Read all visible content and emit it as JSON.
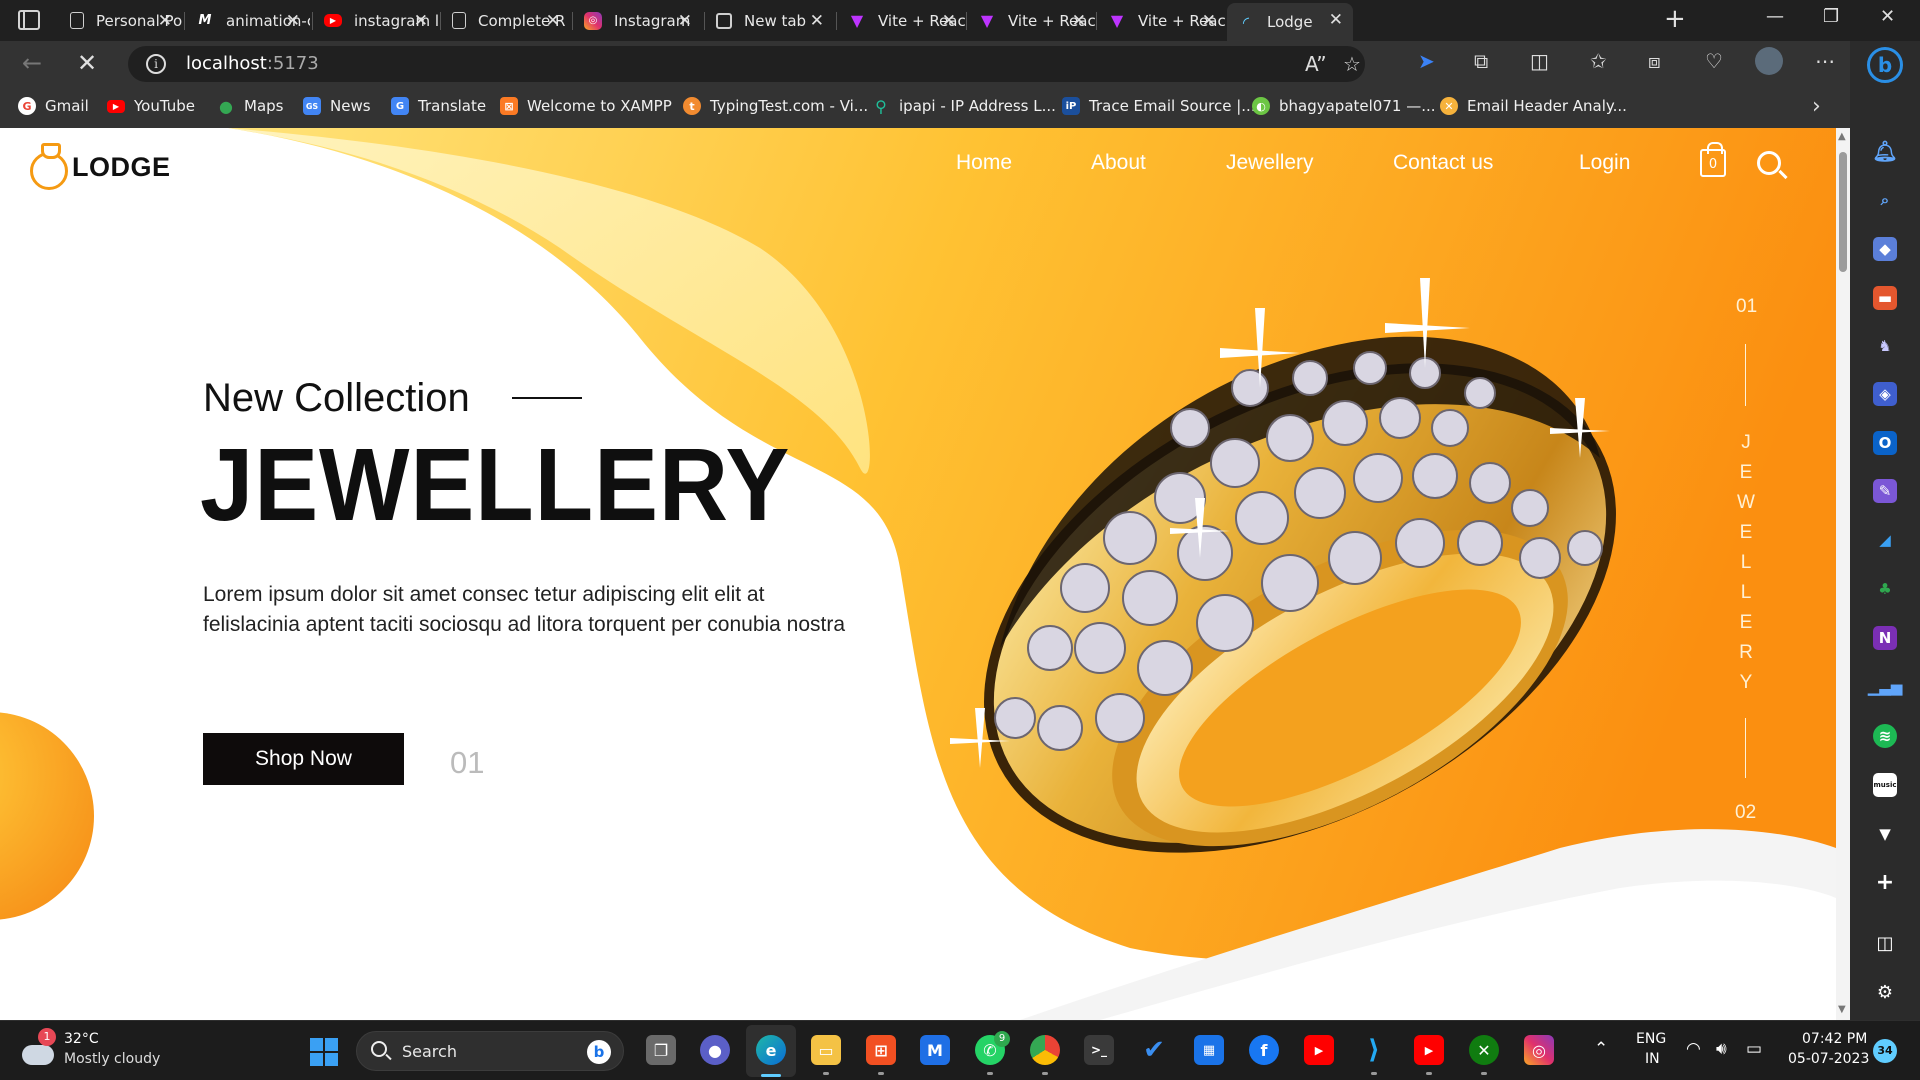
{
  "browser": {
    "tabs": [
      {
        "title": "Personal Po",
        "favicon": "document-icon",
        "color": "#cfcfcf"
      },
      {
        "title": "animation-c",
        "favicon": "medium-icon",
        "color": "#ffffff"
      },
      {
        "title": "instagram li",
        "favicon": "youtube-icon",
        "color": "#ff0000"
      },
      {
        "title": "Complete R",
        "favicon": "document-icon",
        "color": "#cfcfcf"
      },
      {
        "title": "Instagram",
        "favicon": "instagram-icon",
        "color": "#e1306c"
      },
      {
        "title": "New tab",
        "favicon": "newtab-icon",
        "color": "#cfcfcf"
      },
      {
        "title": "Vite + Reac",
        "favicon": "vite-icon",
        "color": "#a259ff"
      },
      {
        "title": "Vite + Reac",
        "favicon": "vite-icon",
        "color": "#a259ff"
      },
      {
        "title": "Vite + Reac",
        "favicon": "vite-icon",
        "color": "#a259ff"
      },
      {
        "title": "Lodge",
        "favicon": "loading-icon",
        "color": "#60cdff"
      }
    ],
    "url_host": "localhost",
    "url_port": ":5173",
    "bookmarks": [
      {
        "label": "Gmail",
        "icon": "google-icon",
        "color": "#ea4335"
      },
      {
        "label": "YouTube",
        "icon": "youtube-icon",
        "color": "#ff0000"
      },
      {
        "label": "Maps",
        "icon": "maps-icon",
        "color": "#34a853"
      },
      {
        "label": "News",
        "icon": "news-icon",
        "color": "#4285f4"
      },
      {
        "label": "Translate",
        "icon": "translate-icon",
        "color": "#4285f4"
      },
      {
        "label": "Welcome to XAMPP",
        "icon": "xampp-icon",
        "color": "#fb7a24"
      },
      {
        "label": "TypingTest.com - Vi...",
        "icon": "typingtest-icon",
        "color": "#f28b30"
      },
      {
        "label": "ipapi - IP Address L...",
        "icon": "location-pin-icon",
        "color": "#1fbf9a"
      },
      {
        "label": "Trace Email Source |...",
        "icon": "ip-icon",
        "color": "#1b4f9c"
      },
      {
        "label": "bhagyapatel071 —...",
        "icon": "github-icon",
        "color": "#6cc644"
      },
      {
        "label": "Email Header Analy...",
        "icon": "mail-analyzer-icon",
        "color": "#f6b23c"
      }
    ]
  },
  "site": {
    "logo": "LODGE",
    "nav": [
      "Home",
      "About",
      "Jewellery",
      "Contact us",
      "Login"
    ],
    "cart_count": "0",
    "hero": {
      "subtitle": "New Collection",
      "title": "JEWELLERY",
      "description": "Lorem ipsum dolor sit amet consec tetur adipiscing elit elit at felislacinia aptent taciti sociosqu ad litora torquent per conubia nostra",
      "cta": "Shop Now",
      "slide": "01"
    },
    "side_indicator": {
      "top": "01",
      "word": "JEWELLERY",
      "bottom": "02"
    },
    "colors": {
      "accent": "#f7931a",
      "accent_light": "#ffd54f",
      "dark": "#0e0b0b"
    }
  },
  "taskbar": {
    "weather_temp": "32°C",
    "weather_cond": "Mostly cloudy",
    "weather_badge": "1",
    "search_label": "Search",
    "whatsapp_badge": "9",
    "lang_top": "ENG",
    "lang_bottom": "IN",
    "time": "07:42 PM",
    "date": "05-07-2023",
    "notifications": "34"
  }
}
